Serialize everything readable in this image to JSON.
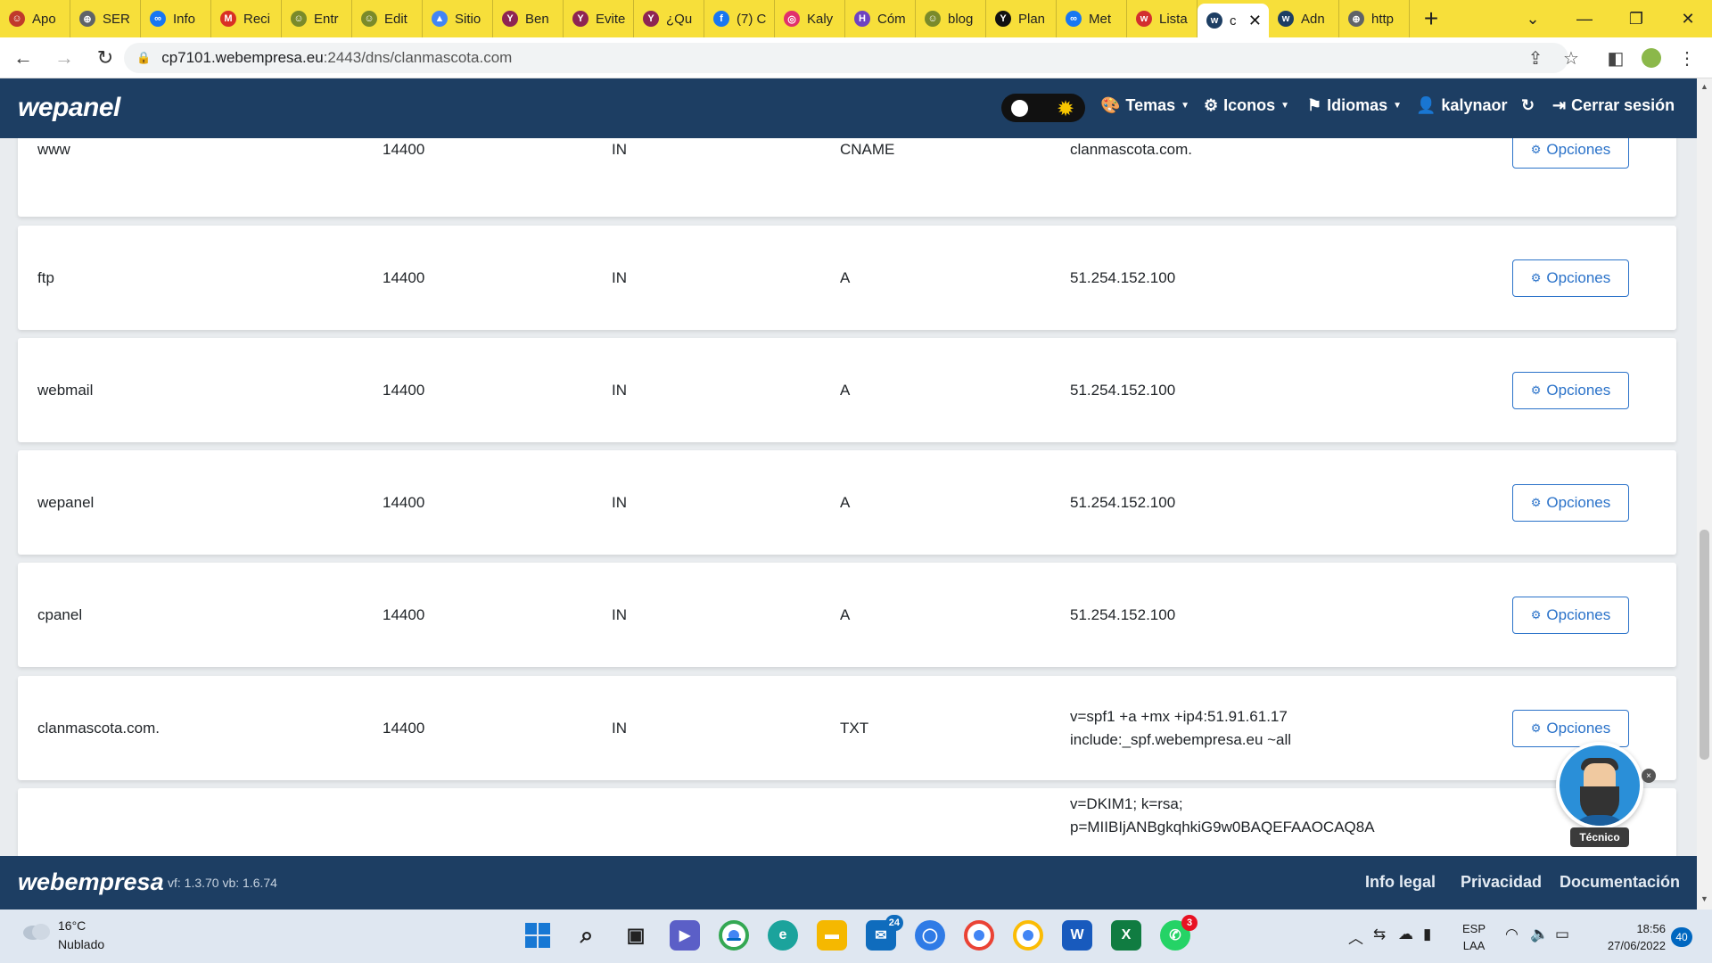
{
  "browser": {
    "tabs": [
      {
        "label": "Apo",
        "color": "#c0392b",
        "glyph": "☺"
      },
      {
        "label": "SER",
        "color": "#5f6368",
        "glyph": "⊕"
      },
      {
        "label": "Info",
        "color": "#1877f2",
        "glyph": "∞"
      },
      {
        "label": "Reci",
        "color": "#d93025",
        "glyph": "M"
      },
      {
        "label": "Entr",
        "color": "#7a8a2a",
        "glyph": "☺"
      },
      {
        "label": "Edit",
        "color": "#7a8a2a",
        "glyph": "☺"
      },
      {
        "label": "Sitio",
        "color": "#4285f4",
        "glyph": "▲"
      },
      {
        "label": "Ben",
        "color": "#8e2453",
        "glyph": "Y"
      },
      {
        "label": "Evite",
        "color": "#8e2453",
        "glyph": "Y"
      },
      {
        "label": "¿Qu",
        "color": "#8e2453",
        "glyph": "Y"
      },
      {
        "label": "(7) C",
        "color": "#1877f2",
        "glyph": "f"
      },
      {
        "label": "Kaly",
        "color": "#e1306c",
        "glyph": "◎"
      },
      {
        "label": "Cóm",
        "color": "#6f42c1",
        "glyph": "H"
      },
      {
        "label": "blog",
        "color": "#7a8a2a",
        "glyph": "☺"
      },
      {
        "label": "Plan",
        "color": "#111111",
        "glyph": "Y"
      },
      {
        "label": "Met",
        "color": "#1877f2",
        "glyph": "∞"
      },
      {
        "label": "Lista",
        "color": "#d32f2f",
        "glyph": "w"
      },
      {
        "label": "c",
        "color": "#1d3e63",
        "glyph": "w",
        "active": true
      },
      {
        "label": "Adn",
        "color": "#1d3e63",
        "glyph": "w"
      },
      {
        "label": "http",
        "color": "#5f6368",
        "glyph": "⊕"
      }
    ],
    "new_tab": "+",
    "url_host": "cp7101.webempresa.eu",
    "url_rest": ":2443/dns/clanmascota.com"
  },
  "header": {
    "brand": "wepanel",
    "menu": [
      {
        "label": "Temas",
        "icon": "palette-icon",
        "caret": true
      },
      {
        "label": "Iconos",
        "icon": "icons-icon",
        "caret": true
      },
      {
        "label": "Idiomas",
        "icon": "flag-icon",
        "caret": true
      },
      {
        "label": "kalynaor",
        "icon": "user-gear-icon",
        "caret": false
      },
      {
        "label": "",
        "icon": "refresh-icon",
        "caret": false
      },
      {
        "label": "Cerrar sesión",
        "icon": "logout-icon",
        "caret": false
      }
    ]
  },
  "records": [
    {
      "name": "www",
      "ttl": "14400",
      "class": "IN",
      "type": "CNAME",
      "record": [
        "clanmascota.com."
      ],
      "button": "Opciones"
    },
    {
      "name": "ftp",
      "ttl": "14400",
      "class": "IN",
      "type": "A",
      "record": [
        "51.254.152.100"
      ],
      "button": "Opciones"
    },
    {
      "name": "webmail",
      "ttl": "14400",
      "class": "IN",
      "type": "A",
      "record": [
        "51.254.152.100"
      ],
      "button": "Opciones"
    },
    {
      "name": "wepanel",
      "ttl": "14400",
      "class": "IN",
      "type": "A",
      "record": [
        "51.254.152.100"
      ],
      "button": "Opciones"
    },
    {
      "name": "cpanel",
      "ttl": "14400",
      "class": "IN",
      "type": "A",
      "record": [
        "51.254.152.100"
      ],
      "button": "Opciones"
    },
    {
      "name": "clanmascota.com.",
      "ttl": "14400",
      "class": "IN",
      "type": "TXT",
      "record": [
        "v=spf1 +a +mx +ip4:51.91.61.17",
        "include:_spf.webempresa.eu ~all"
      ],
      "button": "Opciones"
    },
    {
      "name": "",
      "ttl": "",
      "class": "",
      "type": "",
      "record": [
        "v=DKIM1; k=rsa;",
        "p=MIIBIjANBgkqhkiG9w0BAQEFAAOCAQ8A"
      ],
      "button": ""
    }
  ],
  "footer": {
    "logo": "webempresa",
    "version": "vf: 1.3.70 vb: 1.6.74",
    "links": [
      "Info legal",
      "Privacidad",
      "Documentación"
    ]
  },
  "chatbot": {
    "label": "Técnico",
    "close": "×"
  },
  "taskbar": {
    "weather_temp": "16°C",
    "weather_desc": "Nublado",
    "mail_badge": "24",
    "whatsapp_badge": "3",
    "lang_line1": "ESP",
    "lang_line2": "LAA",
    "time": "18:56",
    "date": "27/06/2022",
    "notifications": "40"
  }
}
